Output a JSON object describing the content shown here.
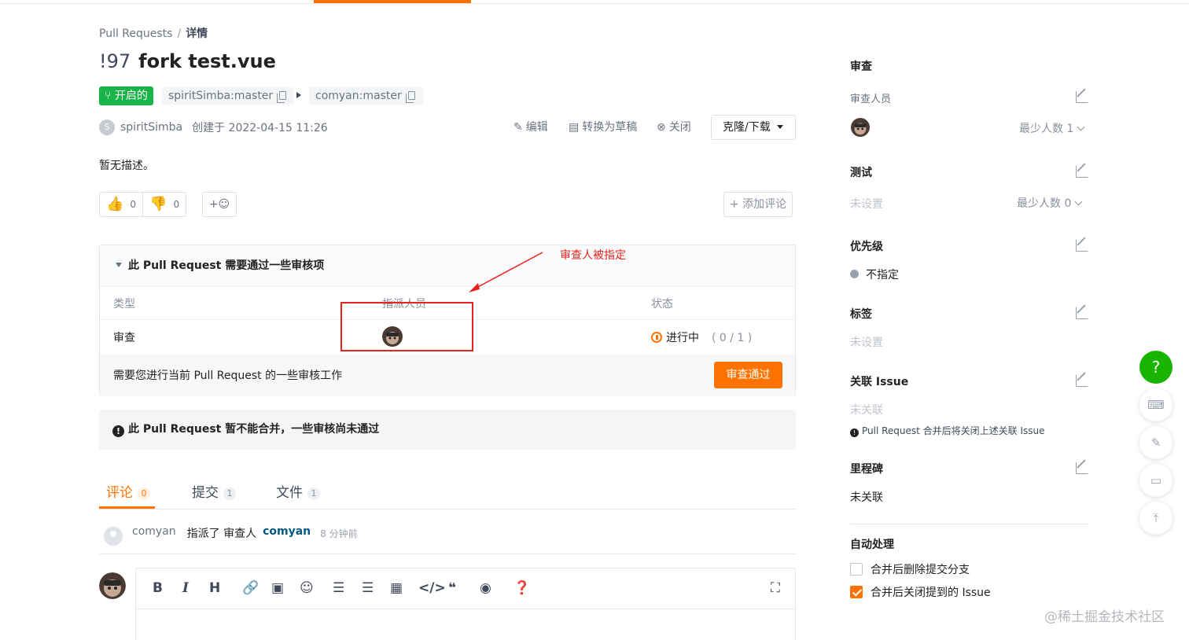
{
  "breadcrumb": {
    "root": "Pull Requests",
    "sep": "/",
    "current": "详情"
  },
  "pr": {
    "number": "!97",
    "title": "fork test.vue",
    "status": "开启的",
    "source_branch": "spiritSimba:master",
    "target_branch": "comyan:master",
    "author_initial": "S",
    "author": "spiritSimba",
    "created": "创建于 2022-04-15 11:26",
    "description": "暂无描述。"
  },
  "actions": {
    "edit": "编辑",
    "draft": "转换为草稿",
    "close": "关闭",
    "clone": "克隆/下载"
  },
  "reactions": {
    "thumbs_up": "0",
    "thumbs_down": "0",
    "add_emoji": "+☺",
    "add_comment": "+ 添加评论"
  },
  "review": {
    "heading": "此 Pull Request 需要通过一些审核项",
    "col_type": "类型",
    "col_assignee": "指派人员",
    "col_status": "状态",
    "row_type": "审查",
    "row_status": "进行中",
    "row_count": "( 0 / 1 )",
    "footer_text": "需要您进行当前 Pull Request 的一些审核工作",
    "approve": "审查通过"
  },
  "warning": {
    "text": "此 Pull Request 暂不能合并，一些审核尚未通过"
  },
  "tabs": [
    {
      "label": "评论",
      "count": "0"
    },
    {
      "label": "提交",
      "count": "1"
    },
    {
      "label": "文件",
      "count": "1"
    }
  ],
  "activity": {
    "user": "comyan",
    "verb": "指派了 审查人",
    "reviewer": "comyan",
    "time": "8 分钟前"
  },
  "toolbar": {
    "bold": "B",
    "italic": "I",
    "heading": "H"
  },
  "sidebar": {
    "review_title": "审查",
    "reviewers_label": "审查人员",
    "reviewers_min": "最少人数 1",
    "test_title": "测试",
    "test_value": "未设置",
    "test_min": "最少人数 0",
    "priority_title": "优先级",
    "priority_value": "不指定",
    "labels_title": "标签",
    "labels_value": "未设置",
    "issue_title": "关联 Issue",
    "issue_value": "未关联",
    "issue_note": "Pull Request 合并后将关闭上述关联 Issue",
    "milestone_title": "里程碑",
    "milestone_value": "未关联",
    "auto_title": "自动处理",
    "auto_delete": "合并后删除提交分支",
    "auto_close": "合并后关闭提到的 Issue"
  },
  "floating": {
    "help": "?"
  },
  "annotation": {
    "text": "审查人被指定"
  },
  "watermark": "@稀土掘金技术社区",
  "colors": {
    "accent": "#fe7300",
    "open": "#18b448",
    "help": "#18b400",
    "annotation": "#e8231e"
  },
  "icons": [
    "thumbs-up-icon",
    "thumbs-down-icon",
    "emoji-icon",
    "copy-icon",
    "edit-icon",
    "draft-icon",
    "close-icon",
    "progress-icon",
    "exclamation-icon",
    "avatar-icon"
  ]
}
